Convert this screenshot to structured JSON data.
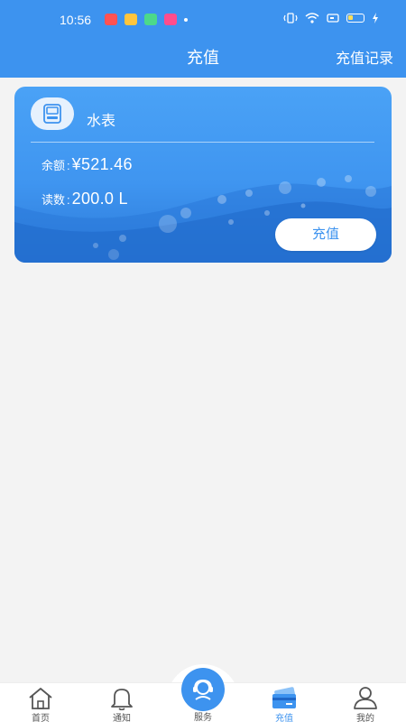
{
  "status_bar": {
    "time": "10:56",
    "apps": [
      {
        "name": "news-app-icon",
        "color": "#ff5252"
      },
      {
        "name": "message-app-icon",
        "color": "#ffc53d"
      },
      {
        "name": "chat-app-icon",
        "color": "#4cd98a"
      },
      {
        "name": "camera-app-icon",
        "color": "#ff4d8d"
      }
    ],
    "battery_color": "#ffde59"
  },
  "header": {
    "title": "充值",
    "record_link": "充值记录",
    "bg_color": "#3d93ef"
  },
  "meter_card": {
    "name": "水表",
    "balance_label": "余额",
    "balance_value": "¥521.46",
    "reading_label": "读数",
    "reading_value": "200.0  L",
    "recharge_button": "充值",
    "accent": "#3d93ef"
  },
  "bottom_nav": {
    "items": [
      {
        "label": "首页",
        "icon": "home-icon",
        "active": false
      },
      {
        "label": "通知",
        "icon": "bell-icon",
        "active": false
      },
      {
        "label": "服务",
        "icon": "service-icon",
        "active": false
      },
      {
        "label": "充值",
        "icon": "card-icon",
        "active": true
      },
      {
        "label": "我的",
        "icon": "user-icon",
        "active": false
      }
    ],
    "active_color": "#3d93ef",
    "inactive_color": "#555555"
  }
}
